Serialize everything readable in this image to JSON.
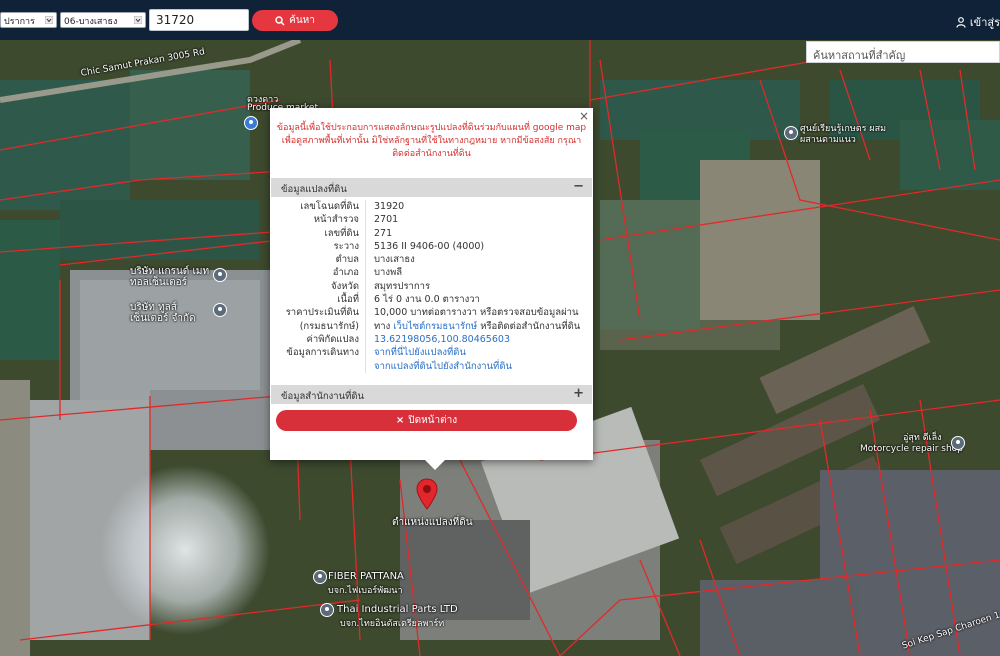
{
  "header": {
    "province_select": "สมุทรปราการ",
    "province_select_visible": "ปราการ",
    "district_select": "06-บางเสาธง",
    "parcel_number_value": "31720",
    "search_button_label": "ค้นหา",
    "login_label": "เข้าสู่ร"
  },
  "map": {
    "place_search_placeholder": "ค้นหาสถานที่สำคัญ",
    "labels": {
      "road": "Chic Samut Prakan 3005 Rd",
      "market_th": "ดวงดาว",
      "market_en": "Produce market",
      "company1": "บริษัท แกรนด์ เมททอลเซ็นเตอร์",
      "company2": "บริษัท ทูลส์ เซ็นเตอร์ จำกัด",
      "school": "ศูนย์เรียนรู้เกษตร ผสมผสานตามแนว",
      "repair_th": "อู่สุท ดีเล็ง",
      "repair_en": "Motorcycle repair shop",
      "fiber": "FIBER PATTANA",
      "fiber_th": "บจก.ไฟเบอร์พัฒนา",
      "thai_parts": "Thai Industrial Parts LTD",
      "thai_parts_th": "บจก.ไทยอินดัสเตรียลพาร์ท",
      "parcel_pos": "ตำแหน่งแปลงที่ดิน",
      "soi": "Soi Kep Sap Charoen 1"
    }
  },
  "popup": {
    "close_symbol": "×",
    "notice": "ข้อมูลนี้เพื่อใช้ประกอบการแสดงลักษณะรูปแปลงที่ดินร่วมกับแผนที่ google map เพื่อดูสภาพพื้นที่เท่านั้น มิใช่หลักฐานที่ใช้ในทางกฎหมาย หากมีข้อสงสัย กรุณาติดต่อสำนักงานที่ดิน",
    "section_land": "ข้อมูลแปลงที่ดิน",
    "section_land_toggle": "−",
    "section_office": "ข้อมูลสำนักงานที่ดิน",
    "section_office_toggle": "+",
    "rows": [
      {
        "label": "เลขโฉนดที่ดิน",
        "value": "31920"
      },
      {
        "label": "หน้าสำรวจ",
        "value": "2701"
      },
      {
        "label": "เลขที่ดิน",
        "value": "271"
      },
      {
        "label": "ระวาง",
        "value": "5136 II 9406-00 (4000)"
      },
      {
        "label": "ตำบล",
        "value": "บางเสาธง"
      },
      {
        "label": "อำเภอ",
        "value": "บางพลี"
      },
      {
        "label": "จังหวัด",
        "value": "สมุทรปราการ"
      },
      {
        "label": "เนื้อที่",
        "value": "6 ไร่ 0 งาน 0.0 ตารางวา"
      }
    ],
    "appraisal_label_1": "ราคาประเมินที่ดิน",
    "appraisal_label_2": "(กรมธนารักษ์)",
    "appraisal_value_1": "10,000 บาทต่อตารางวา หรือตรวจสอบข้อมูลผ่าน",
    "appraisal_value_2a": "ทาง",
    "appraisal_link": "เว็บไซต์กรมธนารักษ์",
    "appraisal_value_2b": "หรือติดต่อสำนักงานที่ดิน",
    "coords_label": "ค่าพิกัดแปลง",
    "coords_value": "13.62198056,100.80465603",
    "travel_label": "ข้อมูลการเดินทาง",
    "travel_link_1": "จากที่นี่ไปยังแปลงที่ดิน",
    "travel_link_2": "จากแปลงที่ดินไปยังสำนักงานที่ดิน",
    "close_button_label": "ปิดหน้าต่าง",
    "close_button_icon": "×"
  },
  "colors": {
    "topbar": "#0f2238",
    "accent_red": "#e4373f",
    "parcel_line": "#e02a2a",
    "notice_text": "#d63030",
    "link": "#2a6fc9"
  }
}
